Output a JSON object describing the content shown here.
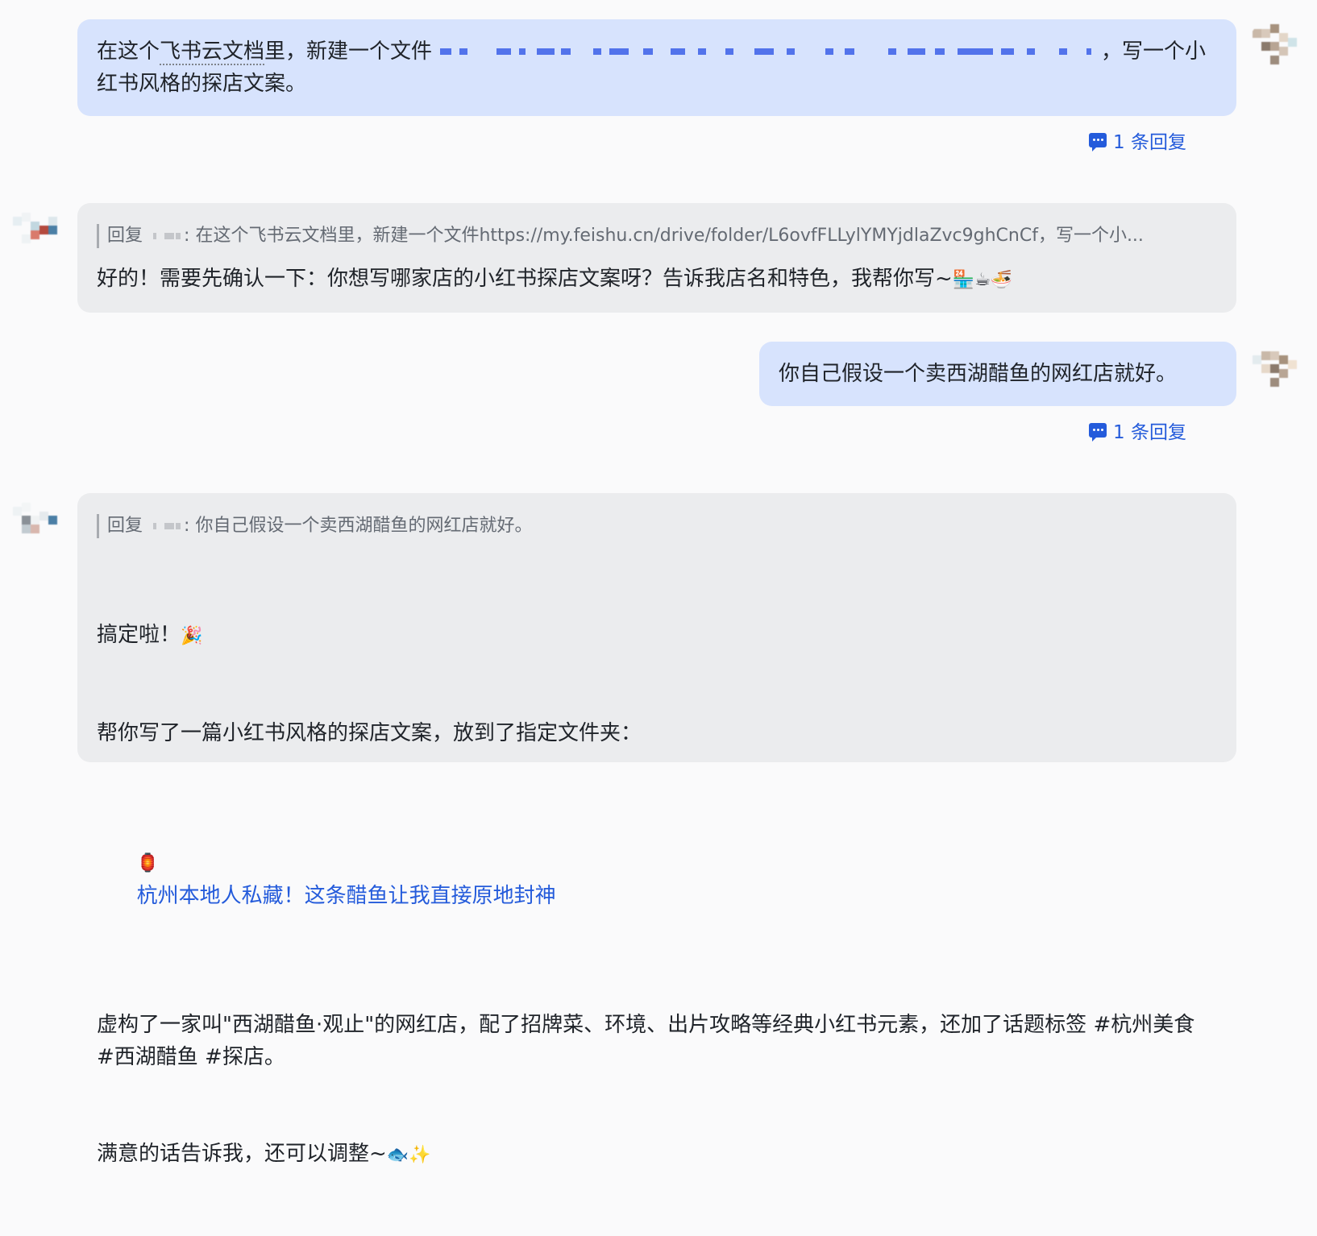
{
  "messages": [
    {
      "text_before": "在这个",
      "text_link": "飞书云文档",
      "text_mid": "里，新建一个文件",
      "text_after": "，写一个小红书风格的探店文案。",
      "reply_count": "1 条回复"
    },
    {
      "quote_prefix": "回复",
      "quote_text": "在这个飞书云文档里，新建一个文件https://my.feishu.cn/drive/folder/L6ovfFLLylYMYjdlaZvc9ghCnCf，写一个小...",
      "text": "好的！需要先确认一下：你想写哪家店的小红书探店文案呀？告诉我店名和特色，我帮你写~",
      "emojis": "🏪☕🍜"
    },
    {
      "text": "你自己假设一个卖西湖醋鱼的网红店就好。",
      "reply_count": "1 条回复"
    },
    {
      "quote_prefix": "回复",
      "quote_text": "你自己假设一个卖西湖醋鱼的网红店就好。",
      "line1": "搞定啦！",
      "line1_emoji": "🎉",
      "line2": "帮你写了一篇小红书风格的探店文案，放到了指定文件夹：",
      "doc_icon": "🏮",
      "doc_link": "杭州本地人私藏！这条醋鱼让我直接原地封神",
      "line3": "虚构了一家叫\"西湖醋鱼·观止\"的网红店，配了招牌菜、环境、出片攻略等经典小红书元素，还加了话题标签 #杭州美食 #西湖醋鱼 #探店。",
      "line4": "满意的话告诉我，还可以调整~",
      "line4_emoji": "🐟✨"
    }
  ],
  "colors": {
    "user_bubble": "#d7e3fd",
    "bot_bubble": "#ebecee",
    "link": "#245bdb"
  },
  "icons": {
    "reply": "comment-icon"
  }
}
